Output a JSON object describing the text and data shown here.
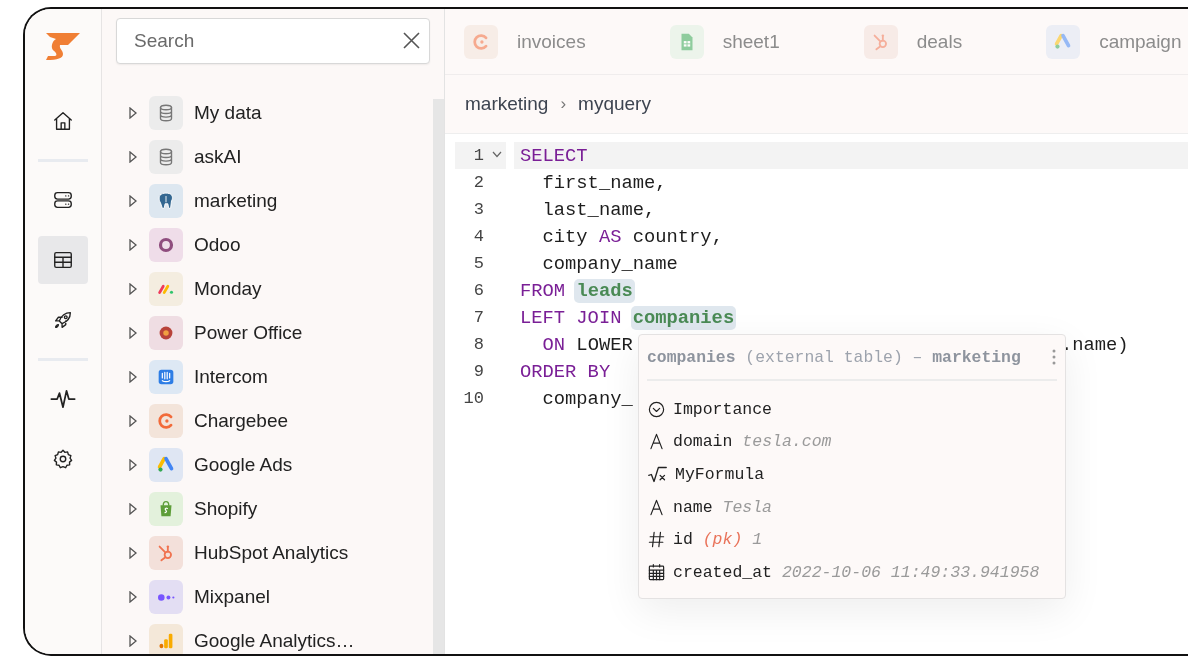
{
  "rail": [
    {
      "kind": "home",
      "selected": false
    },
    {
      "kind": "servers",
      "selected": false
    },
    {
      "kind": "table",
      "selected": true
    },
    {
      "kind": "rocket",
      "selected": false
    },
    {
      "kind": "pulse",
      "selected": false
    },
    {
      "kind": "settings",
      "selected": false
    }
  ],
  "search": {
    "placeholder": "Search"
  },
  "tree": [
    {
      "label": "My data",
      "kind": "database",
      "expanded": false
    },
    {
      "label": "askAI",
      "kind": "database",
      "expanded": false
    },
    {
      "label": "marketing",
      "kind": "postgres",
      "expanded": false
    },
    {
      "label": "Odoo",
      "kind": "odoo",
      "expanded": false
    },
    {
      "label": "Monday",
      "kind": "monday",
      "expanded": false
    },
    {
      "label": "Power Office",
      "kind": "poweroffice",
      "expanded": false
    },
    {
      "label": "Intercom",
      "kind": "intercom",
      "expanded": false
    },
    {
      "label": "Chargebee",
      "kind": "chargebee",
      "expanded": false
    },
    {
      "label": "Google Ads",
      "kind": "googleads",
      "expanded": false
    },
    {
      "label": "Shopify",
      "kind": "shopify",
      "expanded": false
    },
    {
      "label": "HubSpot Analytics",
      "kind": "hubspot",
      "expanded": false
    },
    {
      "label": "Mixpanel",
      "kind": "mixpanel",
      "expanded": false
    },
    {
      "label": "Google Analytics…",
      "kind": "analytics",
      "expanded": false
    }
  ],
  "tabs": [
    {
      "label": "invoices",
      "kind": "chargebee",
      "selected": false
    },
    {
      "label": "sheet1",
      "kind": "sheet",
      "selected": false
    },
    {
      "label": "deals",
      "kind": "hubspot",
      "selected": false
    },
    {
      "label": "campaign",
      "kind": "googleads",
      "selected": false
    }
  ],
  "breadcrumb": {
    "items": [
      "marketing",
      "myquery"
    ],
    "separator": "›"
  },
  "editor": {
    "lines": [
      {
        "number": "1",
        "active": true,
        "foldable": true,
        "indented": false,
        "tokens": [
          {
            "text": "SELECT",
            "kind": "keyword"
          }
        ]
      },
      {
        "number": "2",
        "active": false,
        "foldable": false,
        "indented": true,
        "tokens": [
          {
            "text": "first_name,",
            "kind": "plain"
          }
        ]
      },
      {
        "number": "3",
        "active": false,
        "foldable": false,
        "indented": true,
        "tokens": [
          {
            "text": "last_name,",
            "kind": "plain"
          }
        ]
      },
      {
        "number": "4",
        "active": false,
        "foldable": false,
        "indented": true,
        "tokens": [
          {
            "text": "city",
            "kind": "plain"
          },
          {
            "text": "AS",
            "kind": "keyword"
          },
          {
            "text": "country,",
            "kind": "plain"
          }
        ]
      },
      {
        "number": "5",
        "active": false,
        "foldable": false,
        "indented": true,
        "tokens": [
          {
            "text": "company_name",
            "kind": "plain"
          }
        ]
      },
      {
        "number": "6",
        "active": false,
        "foldable": false,
        "indented": false,
        "tokens": [
          {
            "text": "FROM",
            "kind": "keyword"
          },
          {
            "text": "leads",
            "kind": "table"
          }
        ]
      },
      {
        "number": "7",
        "active": false,
        "foldable": false,
        "indented": false,
        "tokens": [
          {
            "text": "LEFT JOIN",
            "kind": "keyword"
          },
          {
            "text": "companies",
            "kind": "table"
          }
        ]
      },
      {
        "number": "8",
        "active": false,
        "foldable": false,
        "indented": true,
        "tokens": [
          {
            "text": "ON",
            "kind": "keyword"
          },
          {
            "text": "LOWER",
            "kind": "plain"
          }
        ],
        "tail": ".name)"
      },
      {
        "number": "9",
        "active": false,
        "foldable": false,
        "indented": false,
        "tokens": [
          {
            "text": "ORDER BY",
            "kind": "keyword"
          }
        ]
      },
      {
        "number": "10",
        "active": false,
        "foldable": false,
        "indented": true,
        "tokens": [
          {
            "text": "company_",
            "kind": "plain"
          }
        ]
      }
    ]
  },
  "popup": {
    "title": "**companies** (external table) – **marketing**",
    "fields": [
      {
        "kind": "select",
        "name": "Importance"
      },
      {
        "kind": "text",
        "name": "domain",
        "value": "tesla.com"
      },
      {
        "kind": "formula",
        "name": "MyFormula"
      },
      {
        "kind": "text",
        "name": "name",
        "value": "Tesla"
      },
      {
        "kind": "number",
        "name": "id",
        "note": "(pk)",
        "value": "1"
      },
      {
        "kind": "date",
        "name": "created_at",
        "value": "2022-10-06 11:49:33.941958"
      }
    ]
  }
}
